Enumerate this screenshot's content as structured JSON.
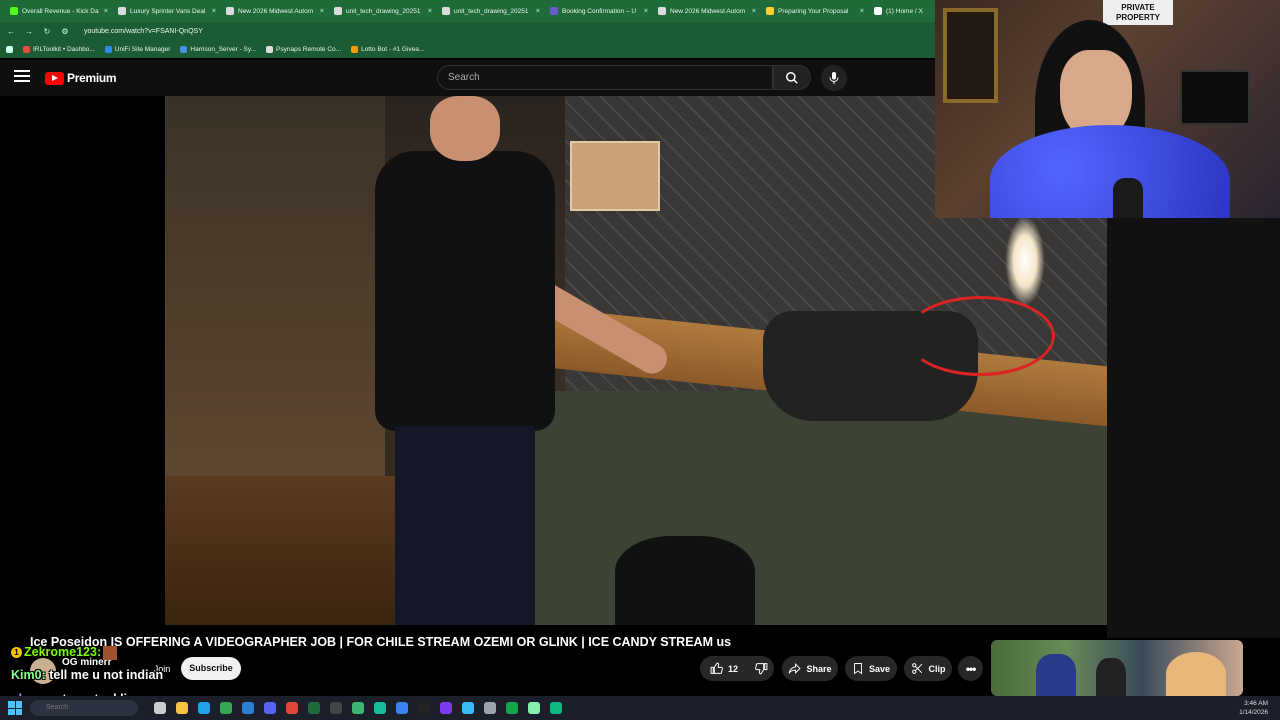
{
  "browser": {
    "tabs": [
      {
        "label": "Overall Revenue - Kick Da",
        "icon": "kick-icon",
        "color": "#53fc18"
      },
      {
        "label": "Luxury Sprinter Vans Deal",
        "icon": "globe-icon",
        "color": "#dddddd"
      },
      {
        "label": "New 2026 Midwest Autom",
        "icon": "page-icon",
        "color": "#dddddd"
      },
      {
        "label": "unit_tech_drawing_20251",
        "icon": "globe-icon",
        "color": "#dddddd"
      },
      {
        "label": "unit_tech_drawing_20251",
        "icon": "globe-icon",
        "color": "#dddddd"
      },
      {
        "label": "Booking Confirmation – U",
        "icon": "booking-icon",
        "color": "#6a5acd"
      },
      {
        "label": "New 2026 Midwest Autom",
        "icon": "globe-icon",
        "color": "#dddddd"
      },
      {
        "label": "Preparing Your Proposal",
        "icon": "proposal-icon",
        "color": "#ffcc33"
      },
      {
        "label": "(1) Home / X",
        "icon": "x-icon",
        "color": "#ffffff"
      }
    ],
    "close_glyph": "×",
    "url": "youtube.com/watch?v=FSANI-QnQSY",
    "bookmarks": [
      {
        "label": "IRLToolkit • Dashbo...",
        "color": "#e74c3c"
      },
      {
        "label": "UniFi Site Manager",
        "color": "#2d8cf0"
      },
      {
        "label": "Harrison_Server - Sy...",
        "color": "#4a90e2"
      },
      {
        "label": "Psynaps Remote Co...",
        "color": "#dddddd"
      },
      {
        "label": "Lotto Bot - #1 Givea...",
        "color": "#ff9900"
      }
    ]
  },
  "youtube": {
    "brand": "Premium",
    "search_placeholder": "Search",
    "video_title": "Ice Poseidon IS OFFERING A VIDEOGRAPHER JOB | FOR CHILE STREAM OZEMI OR GLINK | ICE CANDY STREAM us",
    "channel_name": "OG minerr",
    "join_label": "Join",
    "subscribe_label": "Subscribe",
    "like_count": "12",
    "share_label": "Share",
    "save_label": "Save",
    "clip_label": "Clip"
  },
  "webcam": {
    "sign_text": "PRIVATE PROPERTY"
  },
  "chat": [
    {
      "badge": "1",
      "user": "Zekrome123:",
      "message": ""
    },
    {
      "user": "Kim0:",
      "message": " tell me u not indian"
    },
    {
      "user": "pkox:",
      "message": " get a actual limo"
    }
  ],
  "taskbar": {
    "search_placeholder": "Search",
    "time": "3:46 AM",
    "date": "1/14/2026",
    "icons": [
      {
        "name": "task-view-icon",
        "color": "#cccccc"
      },
      {
        "name": "file-explorer-icon",
        "color": "#f6c343"
      },
      {
        "name": "edge-icon",
        "color": "#1fa3e8"
      },
      {
        "name": "chrome-icon",
        "color": "#34a853"
      },
      {
        "name": "vscode-icon",
        "color": "#2a7fd4"
      },
      {
        "name": "discord-icon",
        "color": "#5865f2"
      },
      {
        "name": "app-red-icon",
        "color": "#e0463a"
      },
      {
        "name": "chrome-green-icon",
        "color": "#1f6b3a"
      },
      {
        "name": "obs-icon",
        "color": "#444444"
      },
      {
        "name": "app-chart-icon",
        "color": "#3cb371"
      },
      {
        "name": "app-teal-icon",
        "color": "#1abc9c"
      },
      {
        "name": "app-blue-icon",
        "color": "#3b82f6"
      },
      {
        "name": "app-dark-icon",
        "color": "#222222"
      },
      {
        "name": "app-purple-icon",
        "color": "#7c3aed"
      },
      {
        "name": "app-sky-icon",
        "color": "#38bdf8"
      },
      {
        "name": "app-gray-icon",
        "color": "#9ca3af"
      },
      {
        "name": "app-green-icon",
        "color": "#16a34a"
      },
      {
        "name": "app-lightgreen-icon",
        "color": "#86efac"
      },
      {
        "name": "app-mint-icon",
        "color": "#10b981"
      }
    ]
  }
}
